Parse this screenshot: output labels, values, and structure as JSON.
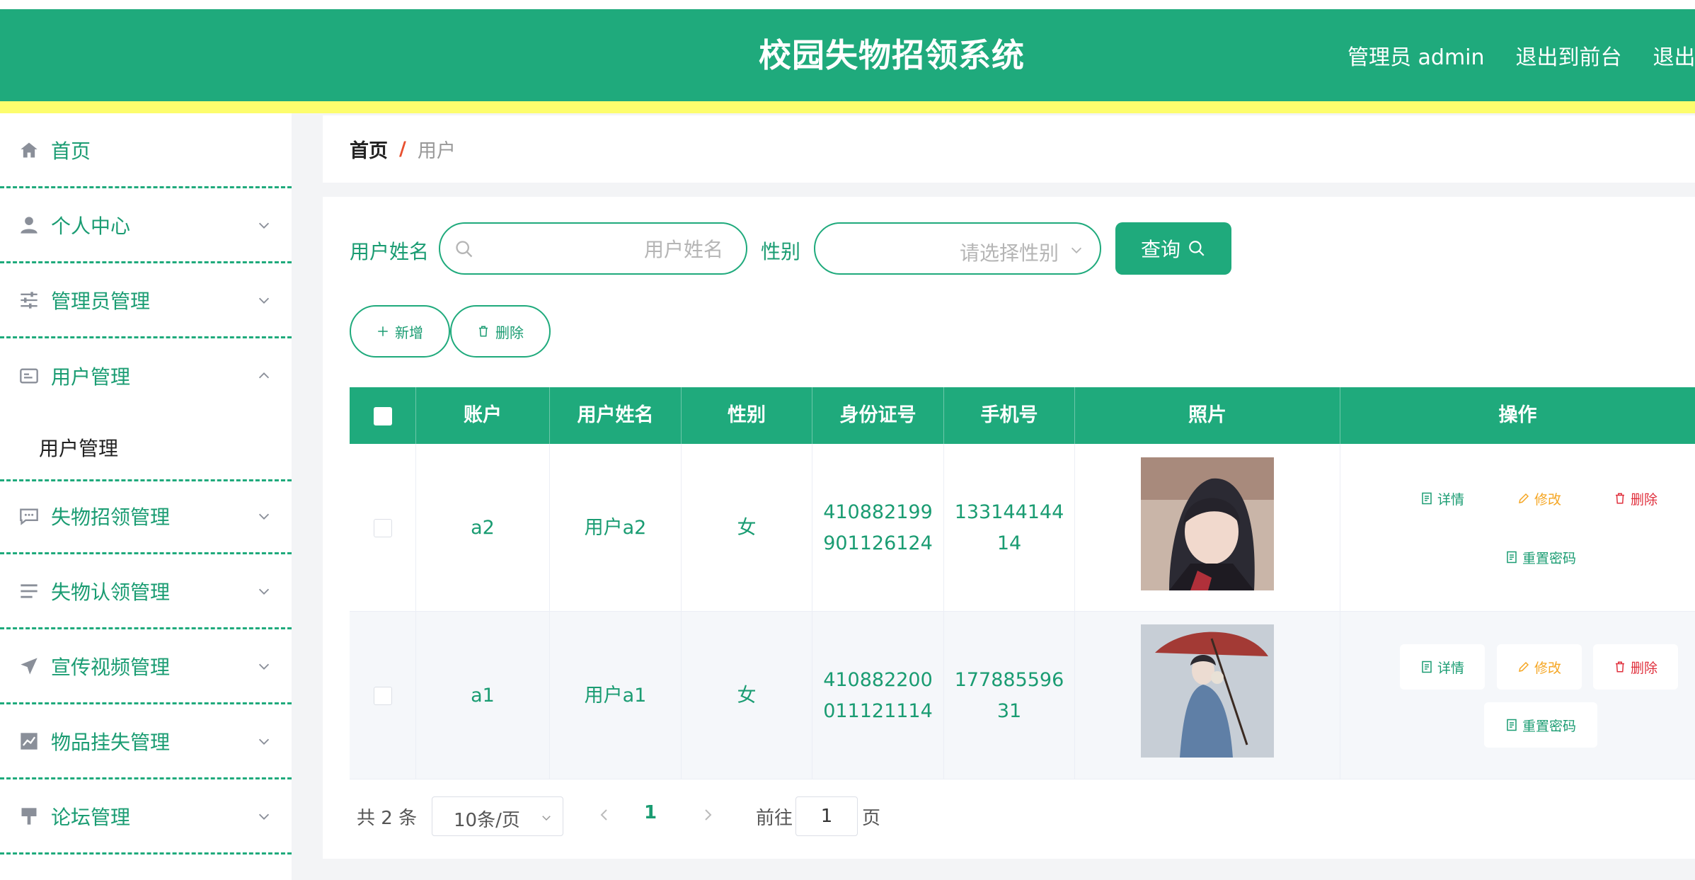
{
  "header": {
    "title": "校园失物招领系统",
    "admin_label": "管理员 admin",
    "front_link": "退出到前台",
    "logout_link": "退出登录"
  },
  "sidebar": {
    "items": [
      {
        "label": "首页",
        "icon": "home-icon"
      },
      {
        "label": "个人中心",
        "icon": "user-icon"
      },
      {
        "label": "管理员管理",
        "icon": "sliders-icon"
      },
      {
        "label": "用户管理",
        "icon": "id-card-icon",
        "expanded": true,
        "sub": "用户管理"
      },
      {
        "label": "失物招领管理",
        "icon": "chat-icon"
      },
      {
        "label": "失物认领管理",
        "icon": "list-icon"
      },
      {
        "label": "宣传视频管理",
        "icon": "send-icon"
      },
      {
        "label": "物品挂失管理",
        "icon": "chart-icon"
      },
      {
        "label": "论坛管理",
        "icon": "brush-icon"
      }
    ]
  },
  "breadcrumb": {
    "home": "首页",
    "separator": "/",
    "current": "用户"
  },
  "search": {
    "name_label": "用户姓名",
    "name_placeholder": "用户姓名",
    "gender_label": "性别",
    "gender_placeholder": "请选择性别",
    "query_button": "查询"
  },
  "actions": {
    "add": "新增",
    "delete": "删除"
  },
  "table": {
    "columns": [
      "账户",
      "用户姓名",
      "性别",
      "身份证号",
      "手机号",
      "照片",
      "操作"
    ],
    "rows": [
      {
        "account": "a2",
        "name": "用户a2",
        "gender": "女",
        "id_line1": "410882199",
        "id_line2": "901126124",
        "phone_line1": "133144144",
        "phone_line2": "14"
      },
      {
        "account": "a1",
        "name": "用户a1",
        "gender": "女",
        "id_line1": "410882200",
        "id_line2": "011121114",
        "phone_line1": "177885596",
        "phone_line2": "31"
      }
    ],
    "ops": {
      "detail": "详情",
      "edit": "修改",
      "delete": "删除",
      "reset": "重置密码"
    }
  },
  "pagination": {
    "total": "共 2 条",
    "page_size": "10条/页",
    "current_page": "1",
    "goto_label": "前往",
    "goto_value": "1",
    "page_suffix": "页"
  },
  "colors": {
    "primary": "#1faa7c",
    "accent_bar": "#fdfd6d",
    "breadcrumb_sep": "#e8502f",
    "edit": "#f5a623",
    "delete": "#e0303d"
  }
}
